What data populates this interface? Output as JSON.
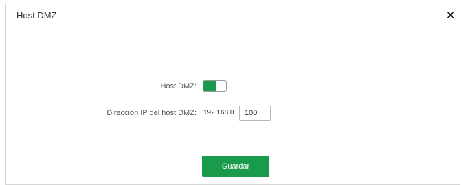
{
  "dialog": {
    "title": "Host DMZ",
    "close_icon": "close-icon"
  },
  "form": {
    "dmz_label": "Host DMZ:",
    "dmz_enabled": true,
    "ip_label": "Dirección IP del host DMZ:",
    "ip_prefix": "192.168.0.",
    "ip_last_octet": "100"
  },
  "actions": {
    "save_label": "Guardar"
  },
  "colors": {
    "accent": "#1a9b4b",
    "border": "#d6d6d6",
    "text": "#333333"
  }
}
